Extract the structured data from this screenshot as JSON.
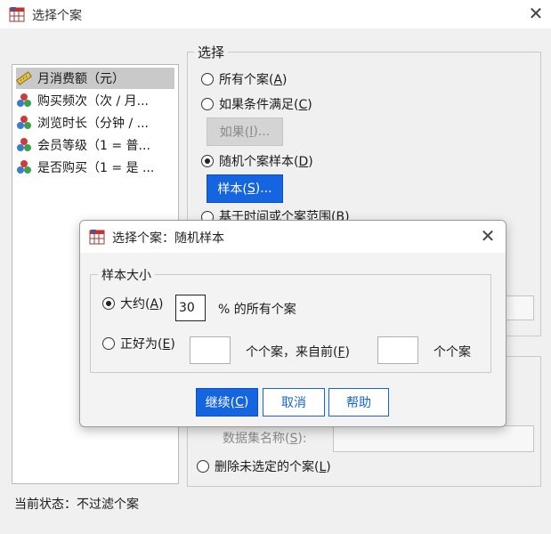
{
  "window": {
    "title": "选择个案"
  },
  "variables": [
    {
      "label": "月消费额（元）",
      "icon": "ruler-icon",
      "selected": true
    },
    {
      "label": "购买频次（次 / 月...",
      "icon": "nominal-balls-icon",
      "selected": false
    },
    {
      "label": "浏览时长（分钟 / ...",
      "icon": "nominal-balls-icon",
      "selected": false
    },
    {
      "label": "会员等级（1 = 普...",
      "icon": "nominal-balls-icon",
      "selected": false
    },
    {
      "label": "是否购买（1 = 是 ...",
      "icon": "nominal-balls-icon",
      "selected": false
    }
  ],
  "select_group": {
    "legend": "选择",
    "all_cases": {
      "text": "所有个案(",
      "key": "A",
      "end": ")"
    },
    "if_condition": {
      "text": "如果条件满足(",
      "key": "C",
      "end": ")"
    },
    "if_button": {
      "text": "如果(",
      "key": "I",
      "end": ")..."
    },
    "random_sample": {
      "text": "随机个案样本(",
      "key": "D",
      "end": ")"
    },
    "sample_button": {
      "text": "样本(",
      "key": "S",
      "end": ")..."
    },
    "time_range": "基于时间或个案范围(B)"
  },
  "output": {
    "dataset_name_label": {
      "text": "数据集名称(",
      "key": "S",
      "end": "):"
    },
    "delete_unselected": {
      "text": "删除未选定的个案(",
      "key": "L",
      "end": ")"
    }
  },
  "status": {
    "text": "当前状态：不过滤个案"
  },
  "dialog": {
    "title": "选择个案：随机样本",
    "legend": "样本大小",
    "approx": {
      "text": "大约(",
      "key": "A",
      "end": ")",
      "value": "30",
      "suffix": "% 的所有个案"
    },
    "exact": {
      "text": "正好为(",
      "key": "E",
      "end": ")",
      "value1": "",
      "mid": "个个案，来自前(",
      "mid_key": "F",
      "mid_end": ")",
      "value2": "",
      "suffix": "个个案"
    },
    "buttons": {
      "continue": {
        "text": "继续(",
        "key": "C",
        "end": ")"
      },
      "cancel": "取消",
      "help": "帮助"
    }
  },
  "colors": {
    "accent": "#1565e0",
    "selected_row": "#c9c9c9"
  }
}
